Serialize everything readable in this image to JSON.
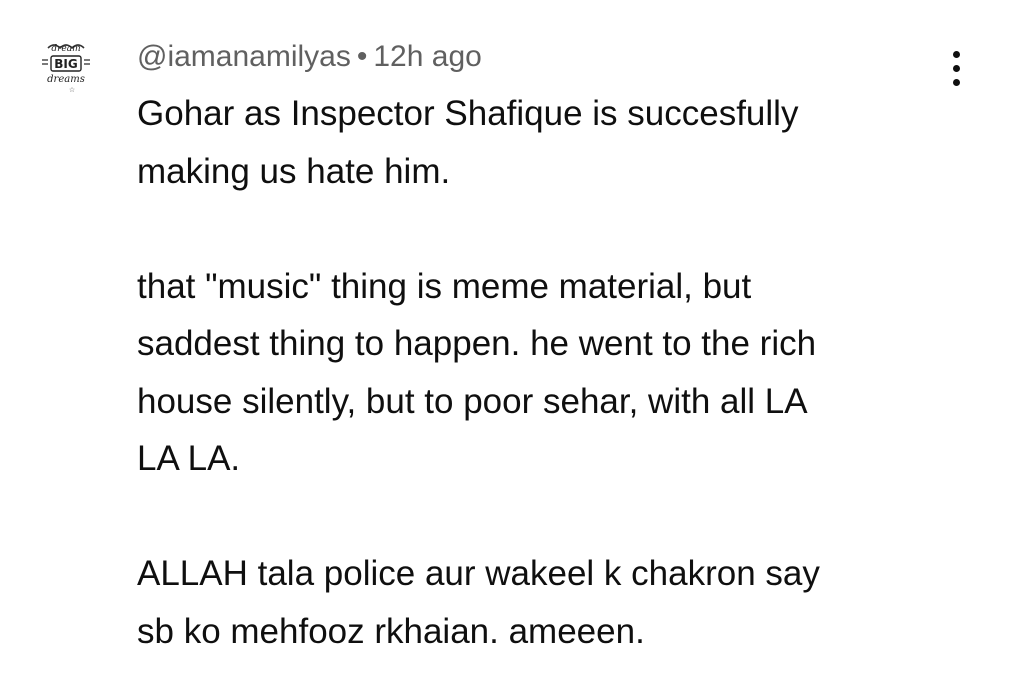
{
  "comment": {
    "author": "@iamanamilyas",
    "separator": "•",
    "timestamp": "12h ago",
    "avatar": {
      "lettering": "Dream BIG dreams",
      "icon": "avatar-image"
    },
    "menu_icon": "more-vert-icon",
    "paragraphs": [
      "Gohar as Inspector Shafique is succesfully\nmaking us hate him.",
      "that \"music\" thing is meme material, but\nsaddest thing to happen.  he went to the rich\nhouse silently, but to poor sehar, with all LA\nLA LA.",
      "ALLAH tala police aur wakeel k chakron say\nsb ko mehfooz rkhaian.  ameeen."
    ]
  }
}
